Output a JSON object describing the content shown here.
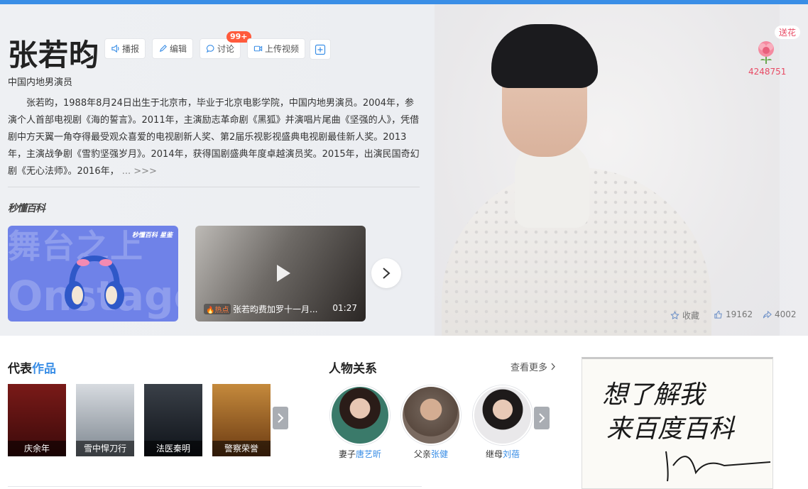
{
  "person": {
    "name": "张若昀",
    "subtitle": "中国内地男演员",
    "summary": "张若昀，1988年8月24日出生于北京市，毕业于北京电影学院，中国内地男演员。2004年，参演个人首部电视剧《海的誓言》。2011年，主演励志革命剧《黑狐》并演唱片尾曲《坚强的人》，凭借剧中方天翼一角夺得最受观众喜爱的电视剧新人奖、第2届乐视影视盛典电视剧最佳新人奖。2013年，主演战争剧《雪豹坚强岁月》。2014年，获得国剧盛典年度卓越演员奖。2015年，出演民国奇幻剧《无心法师》。2016年，",
    "summary_more": "... >>>"
  },
  "toolbar": {
    "broadcast": "播报",
    "edit": "编辑",
    "discuss": "讨论",
    "discuss_badge": "99+",
    "upload_video": "上传视频"
  },
  "miaodong_logo": "秒懂百科",
  "videos": [
    {
      "title_big_1": "舞台之上",
      "title_big_2": "Onstage",
      "logo": "秒懂百科 星鉴"
    },
    {
      "hot_icon": "🔥",
      "hot": "热点",
      "title": "张若昀费加罗十一月...",
      "duration": "01:27"
    }
  ],
  "flower": {
    "send_label": "送花",
    "count": "4248751"
  },
  "actions": {
    "collect": "收藏",
    "likes": "19162",
    "shares": "4002"
  },
  "works": {
    "title_prefix": "代表",
    "title_highlight": "作品",
    "items": [
      "庆余年",
      "雪中悍刀行",
      "法医秦明",
      "警察荣誉"
    ]
  },
  "relations": {
    "title": "人物关系",
    "more": "查看更多",
    "items": [
      {
        "role": "妻子",
        "name": "唐艺昕"
      },
      {
        "role": "父亲",
        "name": "张健"
      },
      {
        "role": "继母",
        "name": "刘蓓"
      }
    ]
  },
  "signature": {
    "line1": "想了解我",
    "line2": "来百度百科"
  },
  "colors": {
    "accent": "#3a8ee6",
    "badge": "#ff5a3c",
    "flower": "#e84a64"
  },
  "icons": [
    "speaker-icon",
    "pencil-icon",
    "chat-icon",
    "video-icon",
    "plus-icon",
    "play-icon",
    "chevron-right-icon",
    "star-icon",
    "thumbs-up-icon",
    "share-icon",
    "flower-icon"
  ]
}
